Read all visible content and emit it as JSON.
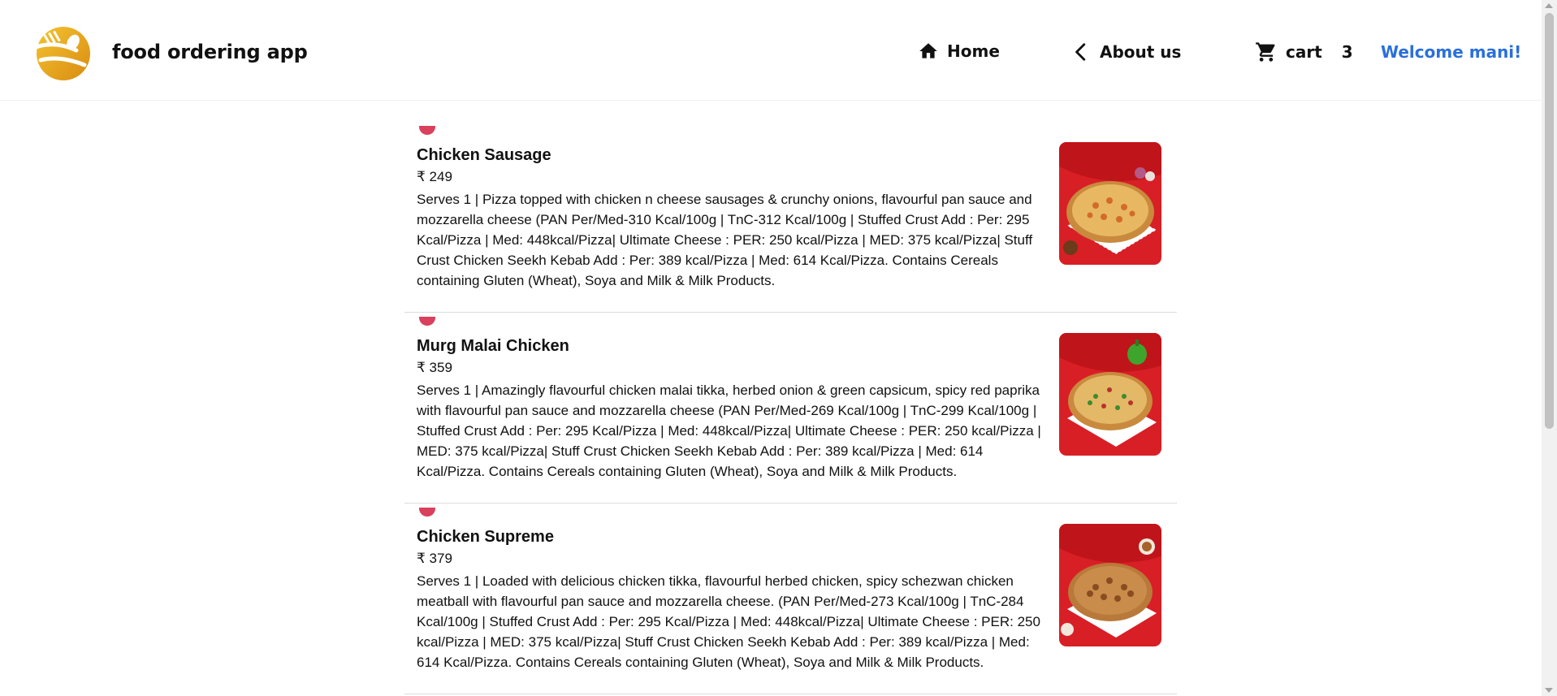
{
  "header": {
    "app_title": "food ordering app",
    "nav": {
      "home_label": "Home",
      "about_label": "About us",
      "cart_label": "cart",
      "cart_count": "3"
    },
    "welcome": "Welcome mani!"
  },
  "colors": {
    "welcome_text": "#2a6fdb",
    "logo_gold": "#e9a825",
    "veg_badge": "#d9405c",
    "image_bg": "#d81f26"
  },
  "icons": [
    "logo-icon",
    "home-icon",
    "chevron-left-icon",
    "cart-icon"
  ],
  "items": [
    {
      "name": "Chicken Sausage",
      "price": "₹ 249",
      "description": "Serves 1 | Pizza topped with chicken n cheese sausages & crunchy onions, flavourful pan sauce and mozzarella cheese (PAN Per/Med-310 Kcal/100g | TnC-312 Kcal/100g | Stuffed Crust Add : Per: 295 Kcal/Pizza | Med: 448kcal/Pizza| Ultimate Cheese : PER: 250 kcal/Pizza | MED: 375 kcal/Pizza| Stuff Crust Chicken Seekh Kebab Add : Per: 389 kcal/Pizza | Med: 614 Kcal/Pizza. Contains Cereals containing Gluten (Wheat), Soya and Milk & Milk Products."
    },
    {
      "name": "Murg Malai Chicken",
      "price": "₹ 359",
      "description": "Serves 1 | Amazingly flavourful chicken malai tikka, herbed onion & green capsicum, spicy red paprika with flavourful pan sauce and mozzarella cheese (PAN Per/Med-269 Kcal/100g | TnC-299 Kcal/100g | Stuffed Crust Add : Per: 295 Kcal/Pizza | Med: 448kcal/Pizza| Ultimate Cheese : PER: 250 kcal/Pizza | MED: 375 kcal/Pizza| Stuff Crust Chicken Seekh Kebab Add : Per: 389 kcal/Pizza | Med: 614 Kcal/Pizza. Contains Cereals containing Gluten (Wheat), Soya and Milk & Milk Products."
    },
    {
      "name": "Chicken Supreme",
      "price": "₹ 379",
      "description": "Serves 1 | Loaded with delicious chicken tikka, flavourful herbed chicken, spicy schezwan chicken meatball with flavourful pan sauce and mozzarella cheese. (PAN Per/Med-273 Kcal/100g | TnC-284 Kcal/100g | Stuffed Crust Add : Per: 295 Kcal/Pizza | Med: 448kcal/Pizza| Ultimate Cheese : PER: 250 kcal/Pizza | MED: 375 kcal/Pizza| Stuff Crust Chicken Seekh Kebab Add : Per: 389 kcal/Pizza | Med: 614 Kcal/Pizza. Contains Cereals containing Gluten (Wheat), Soya and Milk & Milk Products."
    }
  ]
}
